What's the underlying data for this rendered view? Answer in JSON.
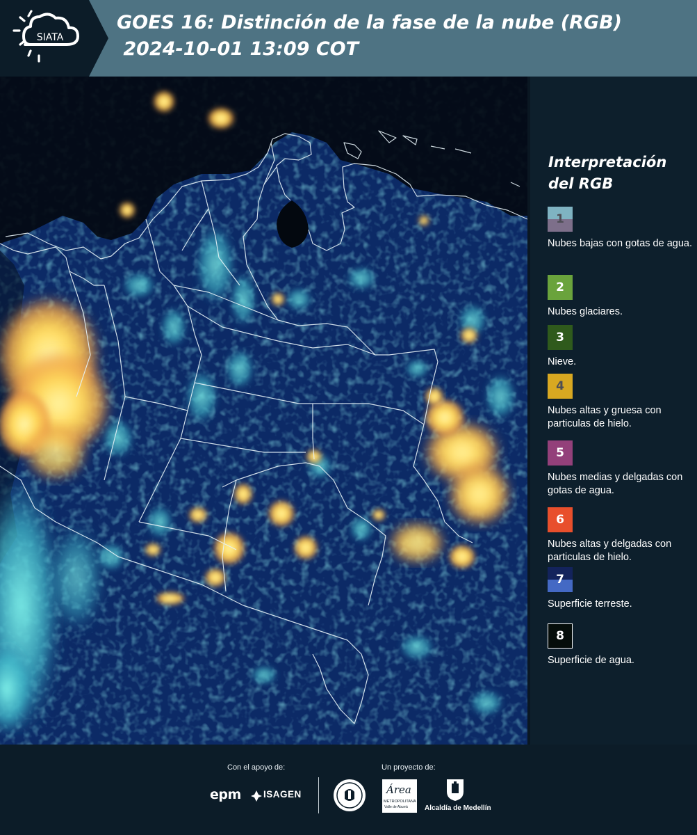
{
  "header": {
    "logo_text": "SIATA",
    "title": "GOES 16: Distinción de la fase de la nube (RGB)\n 2024-10-01 13:09 COT"
  },
  "map": {
    "alt_description": "",
    "colors": {
      "surface": "#0d2a6a",
      "water": "#02070e",
      "high_cloud": "#ffd95a",
      "low_cloud": "#56d8d8",
      "border": "#e6f2f7"
    }
  },
  "legend": {
    "title": "Interpretación del RGB",
    "items": [
      {
        "number": "1",
        "label": "Nubes bajas con gotas de agua.",
        "color_top": "#7fb3c2",
        "color_bottom": "#7d6f8a",
        "number_color": "#4d4d55"
      },
      {
        "number": "2",
        "label": "Nubes glaciares.",
        "color_top": "#6aa33c",
        "color_bottom": "#6aa33c",
        "number_color": "#ffffff"
      },
      {
        "number": "3",
        "label": "Nieve.",
        "color_top": "#2f5a1c",
        "color_bottom": "#2f5a1c",
        "number_color": "#ffffff"
      },
      {
        "number": "4",
        "label": "Nubes altas y gruesa con particulas de hielo.",
        "color_top": "#d8a821",
        "color_bottom": "#d8a821",
        "number_color": "#4d4d55"
      },
      {
        "number": "5",
        "label": "Nubes medias y delgadas con gotas de agua.",
        "color_top": "#93407a",
        "color_bottom": "#93407a",
        "number_color": "#ffffff"
      },
      {
        "number": "6",
        "label": "Nubes altas y delgadas con particulas de hielo.",
        "color_top": "#e84f2c",
        "color_bottom": "#e84f2c",
        "number_color": "#ffffff"
      },
      {
        "number": "7",
        "label": "Superficie terreste.",
        "color_top": "#13235c",
        "color_bottom": "#4469c4",
        "number_color": "#ffffff"
      },
      {
        "number": "8",
        "label": "Superficie de agua.",
        "color_top": "#050d0a",
        "color_bottom": "#050d0a",
        "number_color": "#ffffff"
      }
    ]
  },
  "footer": {
    "support_caption": "Con el apoyo de:",
    "project_caption": "Un proyecto de:",
    "sponsors": {
      "epm": "epm",
      "isagen": "ISAGEN",
      "area_metro": "Área",
      "area_metro_sub": "METROPOLITANA",
      "area_metro_sub2": "Valle de Aburrá",
      "alcaldia": "Alcaldía de Medellín"
    }
  }
}
